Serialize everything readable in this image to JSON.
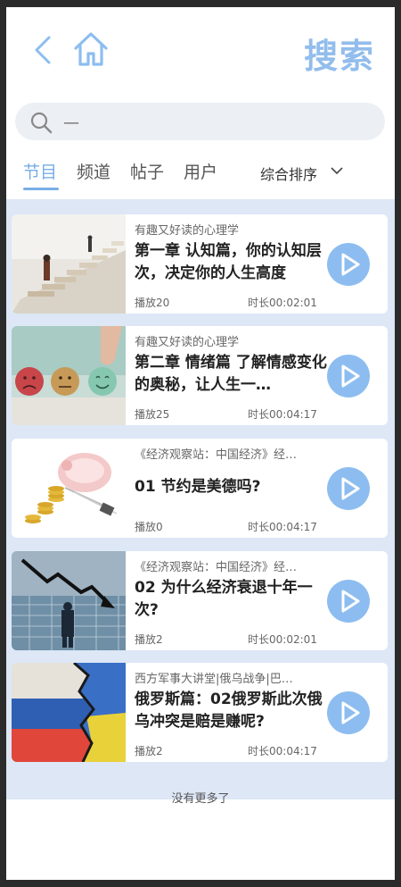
{
  "header": {
    "title": "搜索",
    "back_icon": "chevron-left-icon",
    "home_icon": "home-icon"
  },
  "search": {
    "value": "—",
    "placeholder": ""
  },
  "tabs": [
    {
      "label": "节目",
      "active": true
    },
    {
      "label": "频道",
      "active": false
    },
    {
      "label": "帖子",
      "active": false
    },
    {
      "label": "用户",
      "active": false
    }
  ],
  "sort": {
    "label": "综合排序"
  },
  "colors": {
    "accent": "#78aee6",
    "title": "#92bdec",
    "list_bg": "#dde7f6",
    "play": "#8dbdf0"
  },
  "items": [
    {
      "album": "有趣又好读的心理学",
      "title": "第一章 认知篇，你的认知层次，决定你的人生高度",
      "plays": "播放20",
      "duration": "时长00:02:01",
      "thumb": "stairs-image"
    },
    {
      "album": "有趣又好读的心理学",
      "title": "第二章 情绪篇 了解情感变化的奥秘，让人生一…",
      "plays": "播放25",
      "duration": "时长00:04:17",
      "thumb": "emotion-faces-image"
    },
    {
      "album": "《经济观察站：中国经济》经…",
      "title": "01 节约是美德吗?",
      "plays": "播放0",
      "duration": "时长00:04:17",
      "thumb": "piggy-bank-image"
    },
    {
      "album": "《经济观察站：中国经济》经…",
      "title": "02 为什么经济衰退十年一次?",
      "plays": "播放2",
      "duration": "时长00:02:01",
      "thumb": "recession-chart-image"
    },
    {
      "album": "西方军事大讲堂|俄乌战争|巴…",
      "title": "俄罗斯篇：02俄罗斯此次俄乌冲突是赔是赚呢?",
      "plays": "播放2",
      "duration": "时长00:04:17",
      "thumb": "flags-image"
    }
  ],
  "footer": {
    "no_more": "没有更多了"
  }
}
